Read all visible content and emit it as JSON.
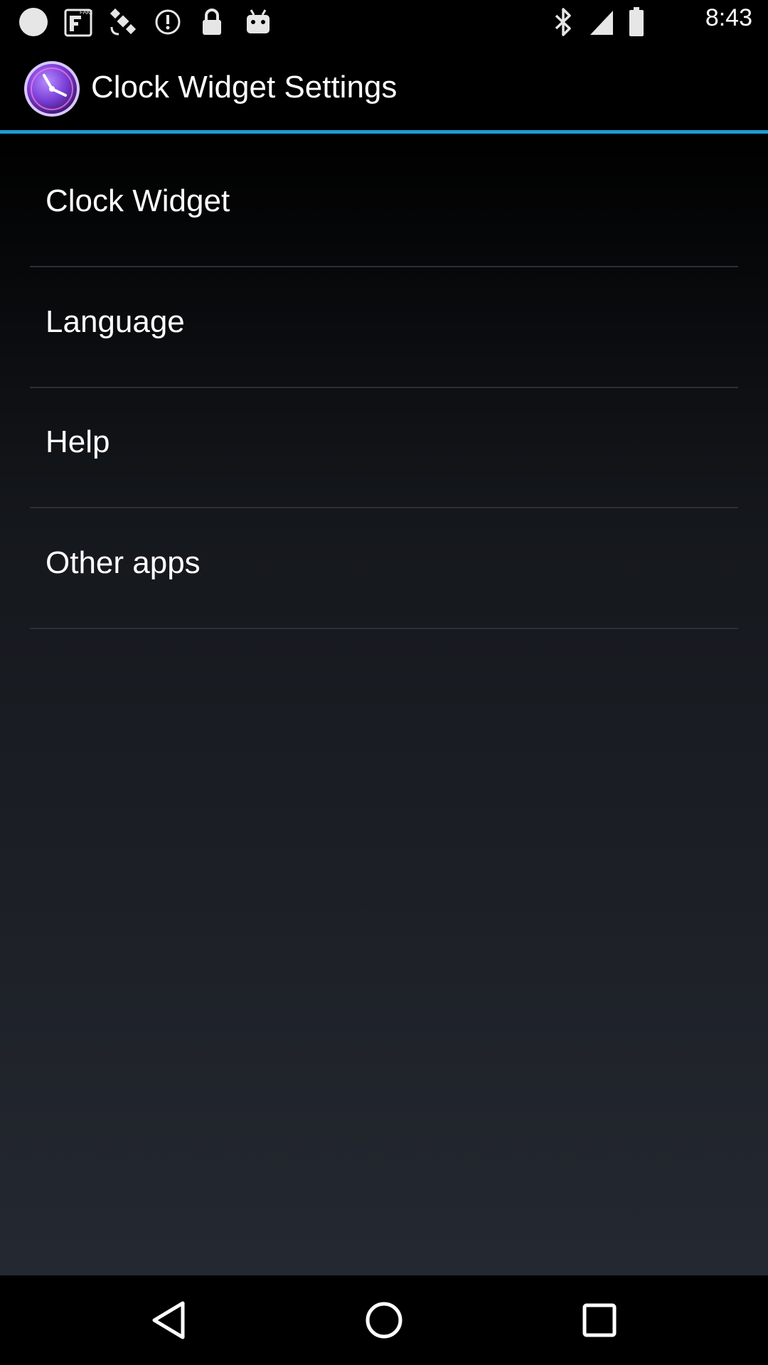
{
  "status_bar": {
    "time": "8:43",
    "icons": [
      "notification-dot-icon",
      "fake-app-icon",
      "satellite-icon",
      "alarm-icon",
      "lock-icon",
      "android-icon",
      "bluetooth-icon",
      "signal-icon",
      "battery-icon"
    ],
    "fake_label": "FAKE"
  },
  "action_bar": {
    "title": "Clock Widget Settings",
    "icon": "clock-icon",
    "divider_color": "#1e9bd6"
  },
  "menu": {
    "items": [
      {
        "label": "Clock Widget"
      },
      {
        "label": "Language"
      },
      {
        "label": "Help"
      },
      {
        "label": "Other apps"
      }
    ]
  },
  "nav_bar": {
    "buttons": [
      "back-icon",
      "home-icon",
      "recents-icon"
    ]
  }
}
